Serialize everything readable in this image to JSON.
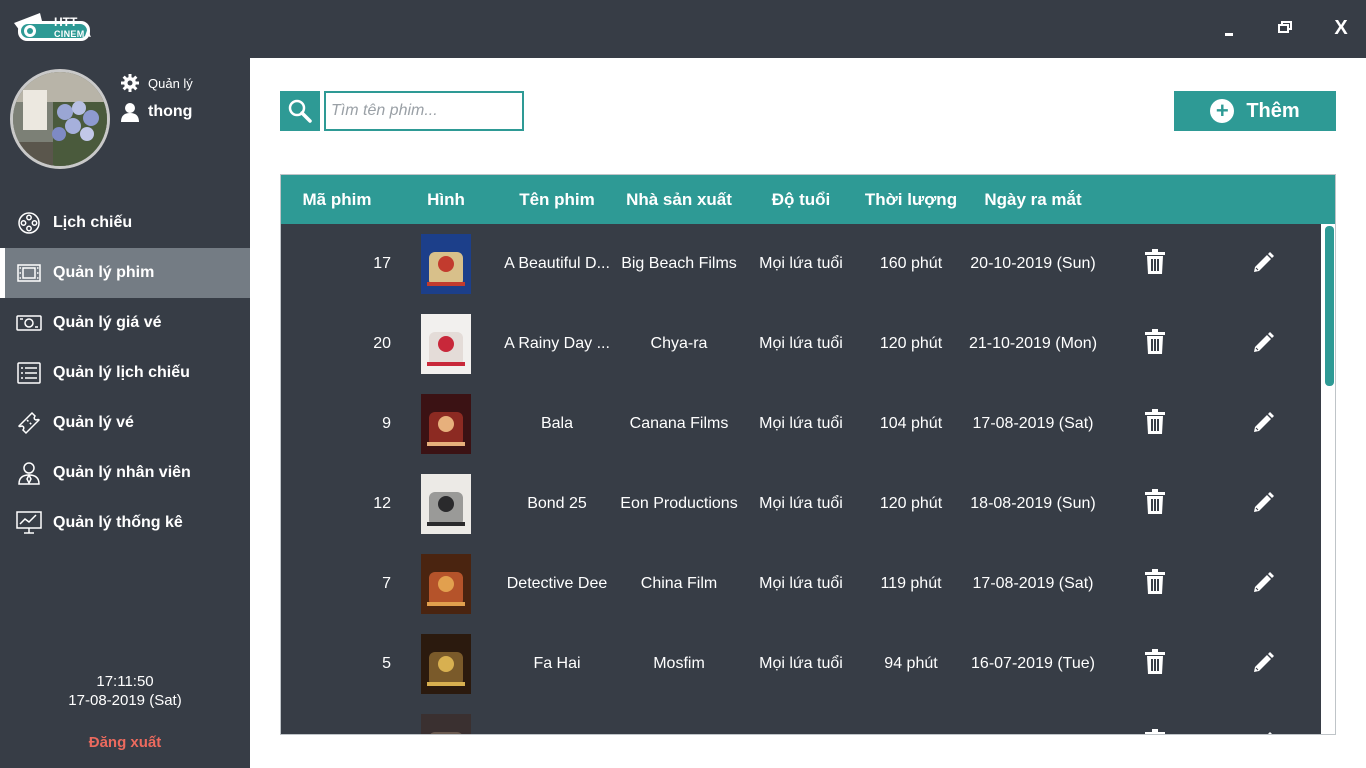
{
  "app": {
    "logo_line1": "HTT",
    "logo_line2": "CINEMA",
    "controls": {
      "minimize": "-",
      "maximize": "🗗",
      "close": "X"
    }
  },
  "user": {
    "role": "Quản lý",
    "name": "thong"
  },
  "nav": [
    {
      "label": "Lịch chiếu",
      "icon": "film-reel-icon",
      "active": false
    },
    {
      "label": "Quản lý phim",
      "icon": "film-strip-icon",
      "active": true
    },
    {
      "label": "Quản lý giá vé",
      "icon": "money-icon",
      "active": false
    },
    {
      "label": "Quản lý lịch chiếu",
      "icon": "schedule-list-icon",
      "active": false
    },
    {
      "label": "Quản lý vé",
      "icon": "ticket-icon",
      "active": false
    },
    {
      "label": "Quản lý nhân viên",
      "icon": "employee-icon",
      "active": false
    },
    {
      "label": "Quản lý thống kê",
      "icon": "chart-icon",
      "active": false
    }
  ],
  "clock": {
    "time": "17:11:50",
    "date": "17-08-2019 (Sat)"
  },
  "logout_label": "Đăng xuất",
  "search": {
    "placeholder": "Tìm tên phim...",
    "value": ""
  },
  "add_label": "Thêm",
  "table": {
    "headers": [
      "Mã phim",
      "Hình",
      "Tên phim",
      "Nhà sản xuất",
      "Độ tuổi",
      "Thời lượng",
      "Ngày ra mắt"
    ],
    "rows": [
      {
        "id": "17",
        "title": "A Beautiful D...",
        "producer": "Big Beach Films",
        "age": "Mọi lứa tuổi",
        "duration": "160 phút",
        "release": "20-10-2019 (Sun)",
        "poster_colors": [
          "#1c3f8a",
          "#d8c08a",
          "#c23b2e"
        ]
      },
      {
        "id": "20",
        "title": "A Rainy Day ...",
        "producer": "Chya-ra",
        "age": "Mọi lứa tuổi",
        "duration": "120 phút",
        "release": "21-10-2019 (Mon)",
        "poster_colors": [
          "#f2f0ee",
          "#e4dcd8",
          "#c8283a"
        ]
      },
      {
        "id": "9",
        "title": "Bala",
        "producer": "Canana Films",
        "age": "Mọi lứa tuổi",
        "duration": "104 phút",
        "release": "17-08-2019 (Sat)",
        "poster_colors": [
          "#3b1214",
          "#8c2a22",
          "#e7b07c"
        ]
      },
      {
        "id": "12",
        "title": "Bond 25",
        "producer": "Eon Productions",
        "age": "Mọi lứa tuổi",
        "duration": "120 phút",
        "release": "18-08-2019 (Sun)",
        "poster_colors": [
          "#eceae6",
          "#9a9a98",
          "#2a2a2c"
        ]
      },
      {
        "id": "7",
        "title": "Detective Dee",
        "producer": "China Film",
        "age": "Mọi lứa tuổi",
        "duration": "119 phút",
        "release": "17-08-2019 (Sat)",
        "poster_colors": [
          "#4a2410",
          "#b5532a",
          "#e2a04e"
        ]
      },
      {
        "id": "5",
        "title": "Fa Hai",
        "producer": "Mosfim",
        "age": "Mọi lứa tuổi",
        "duration": "94 phút",
        "release": "16-07-2019 (Tue)",
        "poster_colors": [
          "#2b1a0e",
          "#7a5a2a",
          "#d8b050"
        ]
      },
      {
        "id": "",
        "title": "",
        "producer": "",
        "age": "",
        "duration": "",
        "release": "",
        "poster_colors": [
          "#3a3030",
          "#6a5a50",
          "#a89080"
        ]
      }
    ]
  },
  "colors": {
    "sidebar": "#373d46",
    "accent": "#2e9a95",
    "active_nav": "#747c84",
    "logout": "#ec6a5e"
  }
}
